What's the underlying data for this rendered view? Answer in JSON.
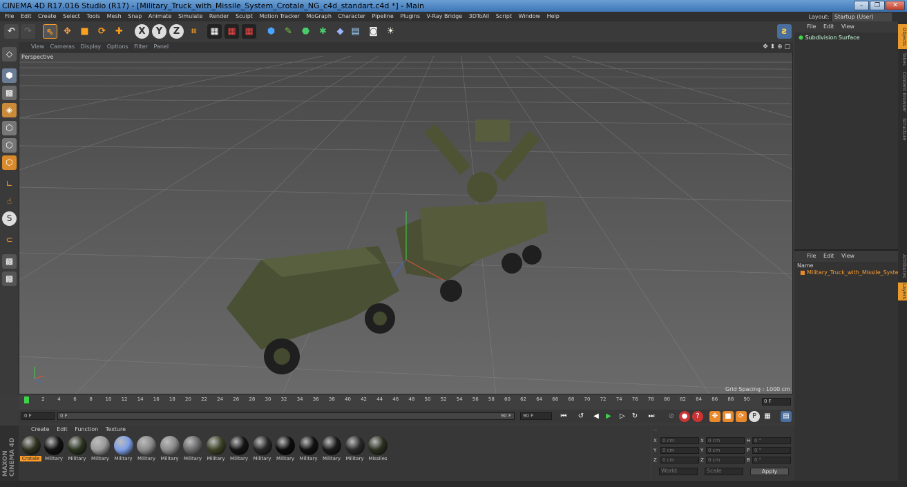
{
  "window": {
    "title": "CINEMA 4D R17.016 Studio (R17) - [Military_Truck_with_Missile_System_Crotale_NG_c4d_standart.c4d *] - Main",
    "controls": [
      "–",
      "❐",
      "✕"
    ]
  },
  "menubar": {
    "items": [
      "File",
      "Edit",
      "Create",
      "Select",
      "Tools",
      "Mesh",
      "Snap",
      "Animate",
      "Simulate",
      "Render",
      "Sculpt",
      "Motion Tracker",
      "MoGraph",
      "Character",
      "Pipeline",
      "Plugins",
      "V-Ray Bridge",
      "3DToAll",
      "Script",
      "Window",
      "Help"
    ],
    "layout_label": "Layout:",
    "layout_value": "Startup (User)"
  },
  "viewport": {
    "menu": [
      "View",
      "Cameras",
      "Display",
      "Options",
      "Filter",
      "Panel"
    ],
    "camera_label": "Perspective",
    "grid_spacing": "Grid Spacing : 1000 cm"
  },
  "timeline": {
    "ticks": [
      "0",
      "2",
      "4",
      "6",
      "8",
      "10",
      "12",
      "14",
      "16",
      "18",
      "20",
      "22",
      "24",
      "26",
      "28",
      "30",
      "32",
      "34",
      "36",
      "38",
      "40",
      "42",
      "44",
      "46",
      "48",
      "50",
      "52",
      "54",
      "56",
      "58",
      "60",
      "62",
      "64",
      "66",
      "68",
      "70",
      "72",
      "74",
      "76",
      "78",
      "80",
      "82",
      "84",
      "86",
      "88",
      "90"
    ],
    "frame_field": "0 F"
  },
  "transport": {
    "start_field": "0 F",
    "slider_start": "0 F",
    "slider_end": "90 F",
    "end_field": "90 F"
  },
  "material_panel": {
    "menu": [
      "Create",
      "Edit",
      "Function",
      "Texture"
    ],
    "materials": [
      {
        "name": "Crotale",
        "color": "#2f3220",
        "selected": true
      },
      {
        "name": "Military",
        "color": "#111111",
        "selected": false
      },
      {
        "name": "Military",
        "color": "#2a331f",
        "selected": false
      },
      {
        "name": "Military",
        "color": "#9a9a9a",
        "selected": false
      },
      {
        "name": "Military",
        "color": "#7d9fe6",
        "selected": false
      },
      {
        "name": "Military",
        "color": "#8a8a8a",
        "selected": false
      },
      {
        "name": "Military",
        "color": "#8a8a8a",
        "selected": false
      },
      {
        "name": "Military",
        "color": "#6a6a6a",
        "selected": false
      },
      {
        "name": "Military",
        "color": "#3c4226",
        "selected": false
      },
      {
        "name": "Military",
        "color": "#141414",
        "selected": false
      },
      {
        "name": "Military",
        "color": "#262626",
        "selected": false
      },
      {
        "name": "Military",
        "color": "#0c0c0c",
        "selected": false
      },
      {
        "name": "Military",
        "color": "#111111",
        "selected": false
      },
      {
        "name": "Military",
        "color": "#1a1a1a",
        "selected": false
      },
      {
        "name": "Military",
        "color": "#2a2a2a",
        "selected": false
      },
      {
        "name": "Missiles",
        "color": "#2a3020",
        "selected": false
      }
    ]
  },
  "coordinates": {
    "header": "--",
    "rows": [
      {
        "a": "X",
        "av": "0 cm",
        "b": "X",
        "bv": "0 cm",
        "c": "H",
        "cv": "0 °"
      },
      {
        "a": "Y",
        "av": "0 cm",
        "b": "Y",
        "bv": "0 cm",
        "c": "P",
        "cv": "0 °"
      },
      {
        "a": "Z",
        "av": "0 cm",
        "b": "Z",
        "bv": "0 cm",
        "c": "B",
        "cv": "0 °"
      }
    ],
    "space": "World",
    "mode": "Scale",
    "apply": "Apply"
  },
  "object_manager": {
    "menu": [
      "File",
      "Edit",
      "View"
    ],
    "objects": [
      "Subdivision Surface"
    ]
  },
  "layer_manager": {
    "menu": [
      "File",
      "Edit",
      "View"
    ],
    "column": "Name",
    "layers": [
      "Military_Truck_with_Missile_System_Crotale_NG"
    ]
  },
  "right_tabs": [
    "Objects",
    "Takes",
    "Content Browser",
    "Structure",
    "Attributes",
    "Layers"
  ],
  "branding": {
    "maxon": "MAXON",
    "product": "CINEMA 4D"
  },
  "colors": {
    "accent": "#ff9d2a",
    "selected_tab": "#e89a2c"
  }
}
